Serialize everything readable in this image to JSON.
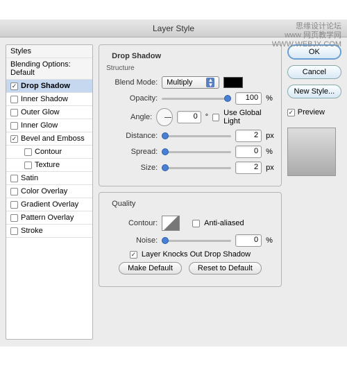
{
  "watermark": {
    "line1": "思缘设计论坛",
    "line2": "www 网页教学网",
    "line3": "WWW.WEBJX.COM"
  },
  "title": "Layer Style",
  "sidebar": {
    "header1": "Styles",
    "header2": "Blending Options: Default",
    "items": [
      {
        "label": "Drop Shadow",
        "checked": true,
        "selected": true
      },
      {
        "label": "Inner Shadow",
        "checked": false
      },
      {
        "label": "Outer Glow",
        "checked": false
      },
      {
        "label": "Inner Glow",
        "checked": false
      },
      {
        "label": "Bevel and Emboss",
        "checked": true
      },
      {
        "label": "Contour",
        "checked": false,
        "indent": true
      },
      {
        "label": "Texture",
        "checked": false,
        "indent": true
      },
      {
        "label": "Satin",
        "checked": false
      },
      {
        "label": "Color Overlay",
        "checked": false
      },
      {
        "label": "Gradient Overlay",
        "checked": false
      },
      {
        "label": "Pattern Overlay",
        "checked": false
      },
      {
        "label": "Stroke",
        "checked": false
      }
    ]
  },
  "panel": {
    "title": "Drop Shadow",
    "structure": {
      "title": "Structure",
      "blend_mode_label": "Blend Mode:",
      "blend_mode_value": "Multiply",
      "opacity_label": "Opacity:",
      "opacity_value": "100",
      "opacity_unit": "%",
      "angle_label": "Angle:",
      "angle_value": "0",
      "angle_unit": "°",
      "global_light": "Use Global Light",
      "distance_label": "Distance:",
      "distance_value": "2",
      "spread_label": "Spread:",
      "spread_value": "0",
      "size_label": "Size:",
      "size_value": "2",
      "px": "px",
      "pct": "%"
    },
    "quality": {
      "title": "Quality",
      "contour_label": "Contour:",
      "antialiased": "Anti-aliased",
      "noise_label": "Noise:",
      "noise_value": "0",
      "noise_unit": "%"
    },
    "knockout": "Layer Knocks Out Drop Shadow",
    "make_default": "Make Default",
    "reset_default": "Reset to Default"
  },
  "buttons": {
    "ok": "OK",
    "cancel": "Cancel",
    "newstyle": "New Style...",
    "preview": "Preview"
  }
}
